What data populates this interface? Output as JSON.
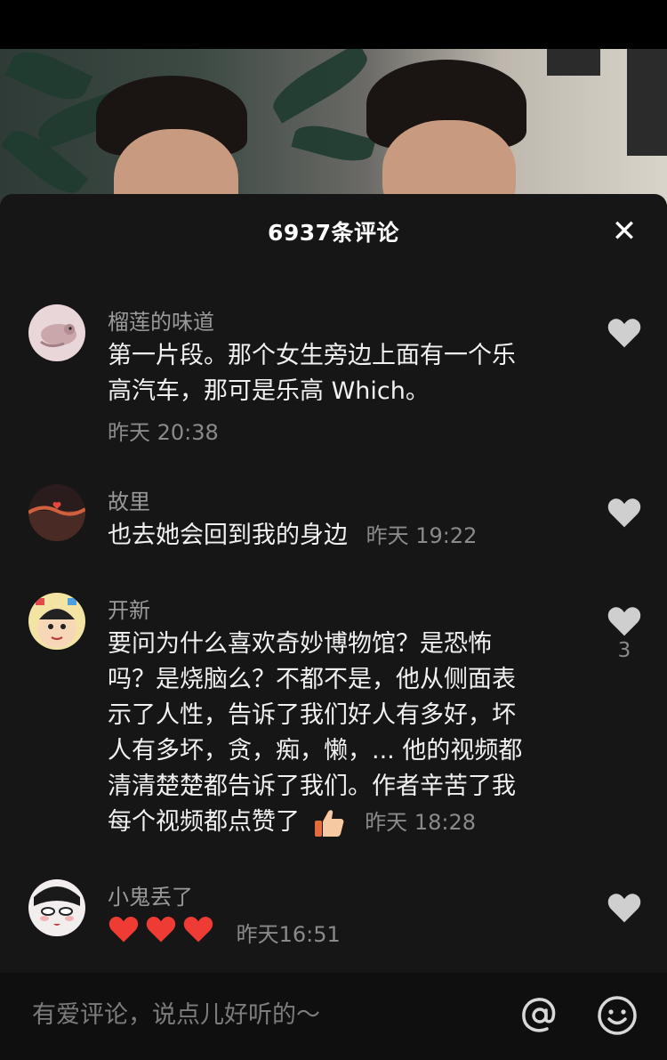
{
  "sheet": {
    "title": "6937条评论"
  },
  "comments": [
    {
      "username": "榴莲的味道",
      "text_line1": "第一片段。那个女生旁边上面有一个乐",
      "text_line2": "高汽车，那可是乐高 Which。",
      "timestamp": "昨天 20:38",
      "likes": ""
    },
    {
      "username": "故里",
      "text": "也去她会回到我的身边",
      "timestamp": "昨天 19:22",
      "likes": ""
    },
    {
      "username": "开新",
      "lines": [
        "要问为什么喜欢奇妙博物馆？是恐怖",
        "吗？是烧脑么？不都不是，他从侧面表",
        "示了人性，告诉了我们好人有多好，坏",
        "人有多坏，贪，痴，懒，... 他的视频都",
        "清清楚楚都告诉了我们。作者辛苦了我"
      ],
      "last_line": "每个视频都点赞了",
      "timestamp": "昨天 18:28",
      "likes": "3"
    },
    {
      "username": "小鬼丢了",
      "timestamp": "昨天16:51",
      "likes": ""
    }
  ],
  "input": {
    "placeholder": "有爱评论，说点儿好听的～"
  },
  "colors": {
    "sheet_bg": "#161616",
    "heart_inactive": "#cfcfcf",
    "heart_red": "#ee3b33"
  }
}
